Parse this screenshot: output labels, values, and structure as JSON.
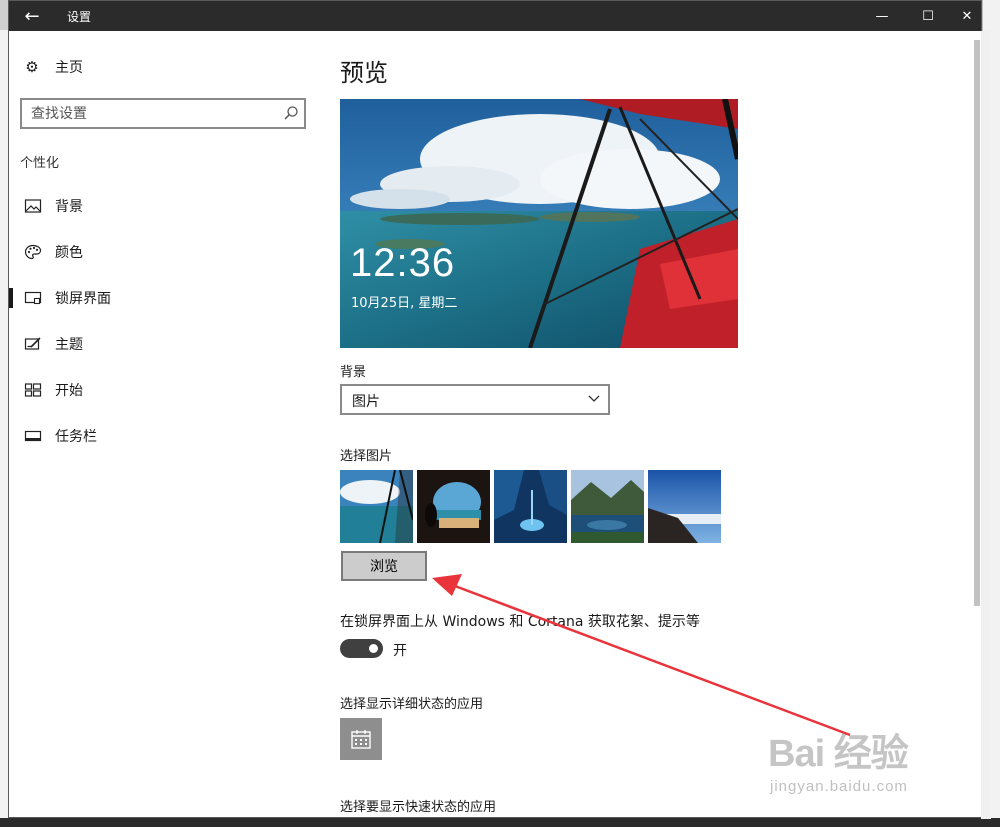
{
  "window": {
    "title": "设置",
    "back_icon": "←",
    "minimize_icon": "—",
    "maximize_icon": "☐",
    "close_icon": "✕"
  },
  "sidebar": {
    "home_label": "主页",
    "search_placeholder": "查找设置",
    "section_title": "个性化",
    "items": [
      {
        "label": "背景",
        "icon": "picture-icon"
      },
      {
        "label": "颜色",
        "icon": "palette-icon"
      },
      {
        "label": "锁屏界面",
        "icon": "lock-screen-icon",
        "active": true
      },
      {
        "label": "主题",
        "icon": "theme-icon"
      },
      {
        "label": "开始",
        "icon": "start-icon"
      },
      {
        "label": "任务栏",
        "icon": "taskbar-icon"
      }
    ]
  },
  "main": {
    "page_title": "预览",
    "preview": {
      "time": "12:36",
      "date": "10月25日, 星期二"
    },
    "background_label": "背景",
    "background_value": "图片",
    "choose_picture_label": "选择图片",
    "browse_label": "浏览",
    "fun_facts_label": "在锁屏界面上从 Windows 和 Cortana 获取花絮、提示等",
    "toggle_state": "开",
    "toggle_on": true,
    "detailed_status_label": "选择显示详细状态的应用",
    "quick_status_label": "选择要显示快速状态的应用"
  },
  "watermark": {
    "main": "Bai 经验",
    "sub": "jingyan.baidu.com"
  },
  "colors": {
    "titlebar": "#2b2b2b",
    "toggle_on": "#404040",
    "arrow": "#e8343a"
  }
}
